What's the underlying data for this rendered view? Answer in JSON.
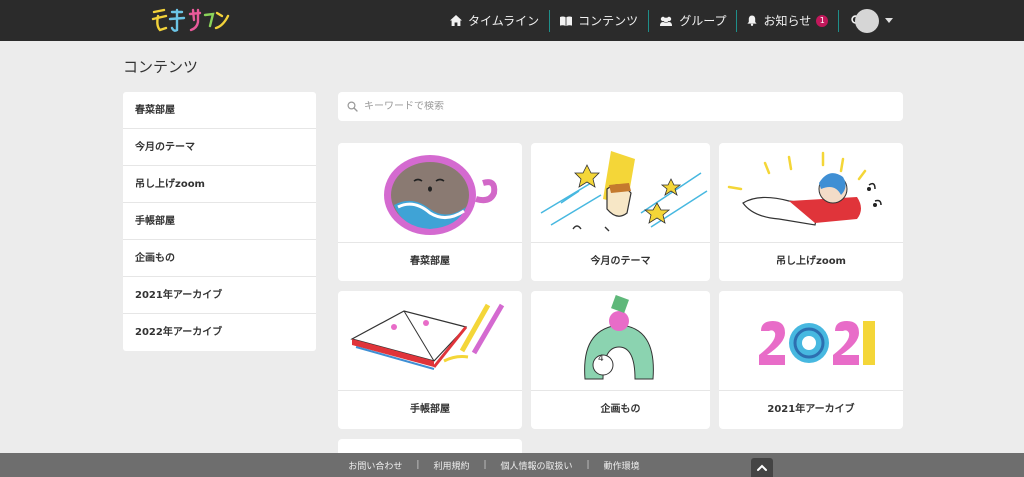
{
  "header": {
    "logo_text": "えほサロン",
    "nav": [
      {
        "label": "タイムライン",
        "icon": "home-icon"
      },
      {
        "label": "コンテンツ",
        "icon": "book-icon"
      },
      {
        "label": "グループ",
        "icon": "users-icon"
      },
      {
        "label": "お知らせ",
        "icon": "bell-icon",
        "badge": "1"
      }
    ],
    "search_icon": "search-icon",
    "avatar_icon": "avatar",
    "menu_icon": "caret-down-icon"
  },
  "page": {
    "title": "コンテンツ"
  },
  "sidebar": {
    "items": [
      {
        "label": "春菜部屋"
      },
      {
        "label": "今月のテーマ"
      },
      {
        "label": "吊し上げzoom"
      },
      {
        "label": "手帳部屋"
      },
      {
        "label": "企画もの"
      },
      {
        "label": "2021年アーカイブ"
      },
      {
        "label": "2022年アーカイブ"
      }
    ]
  },
  "search": {
    "placeholder": "キーワードで検索",
    "value": ""
  },
  "cards": [
    {
      "label": "春菜部屋",
      "illustration": "coffee-cup-illustration"
    },
    {
      "label": "今月のテーマ",
      "illustration": "stars-face-illustration"
    },
    {
      "label": "吊し上げzoom",
      "illustration": "flying-person-illustration"
    },
    {
      "label": "手帳部屋",
      "illustration": "notebook-pencils-illustration"
    },
    {
      "label": "企画もの",
      "illustration": "acrobat-shapes-illustration"
    },
    {
      "label": "2021年アーカイブ",
      "illustration": "year-2021-illustration"
    }
  ],
  "footer": {
    "links": [
      {
        "label": "お問い合わせ"
      },
      {
        "label": "利用規約"
      },
      {
        "label": "個人情報の取扱い"
      },
      {
        "label": "動作環境"
      }
    ],
    "separator": "|",
    "to_top_icon": "chevron-up-icon"
  },
  "colors": {
    "topbar": "#2b2b2b",
    "accent": "#1e8f8a",
    "badge": "#c2185b",
    "footer": "#6e6e6e"
  }
}
